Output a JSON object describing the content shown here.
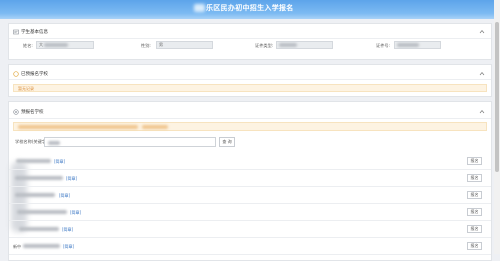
{
  "header": {
    "title": "乐区民办初中招生入学报名"
  },
  "student_info": {
    "title": "学生基本信息",
    "name_label": "姓名:",
    "name_value": "大",
    "gender_label": "性别:",
    "gender_value": "男",
    "id_type_label": "证件类型:",
    "id_number_label": "证件号:"
  },
  "registered": {
    "title": "已预报名学校",
    "empty_text": "暂无记录"
  },
  "pre_register": {
    "title": "预报名学校",
    "search": {
      "label": "学校名称(关键字):",
      "button": "查 询"
    },
    "rows": [
      {
        "link": "[简章]",
        "action": "报名"
      },
      {
        "link": "[简章]",
        "action": "报名"
      },
      {
        "link": "[简章]",
        "action": "报名"
      },
      {
        "link": "[简章]",
        "action": "报名"
      },
      {
        "link": "[简章]",
        "action": "报名"
      },
      {
        "name_prefix": "新中",
        "link": "[简章]",
        "action": "报名"
      }
    ]
  },
  "icons": {
    "student_info": "id-card-icon",
    "registered": "circle-icon",
    "pre_register": "circle-icon",
    "collapse": "chevron-up-icon"
  },
  "colors": {
    "header": "#6aaeee",
    "page_bg": "#eef0f4",
    "notice_bg": "#fdf3e2",
    "notice_text": "#d98a35",
    "link": "#3d78c4"
  }
}
